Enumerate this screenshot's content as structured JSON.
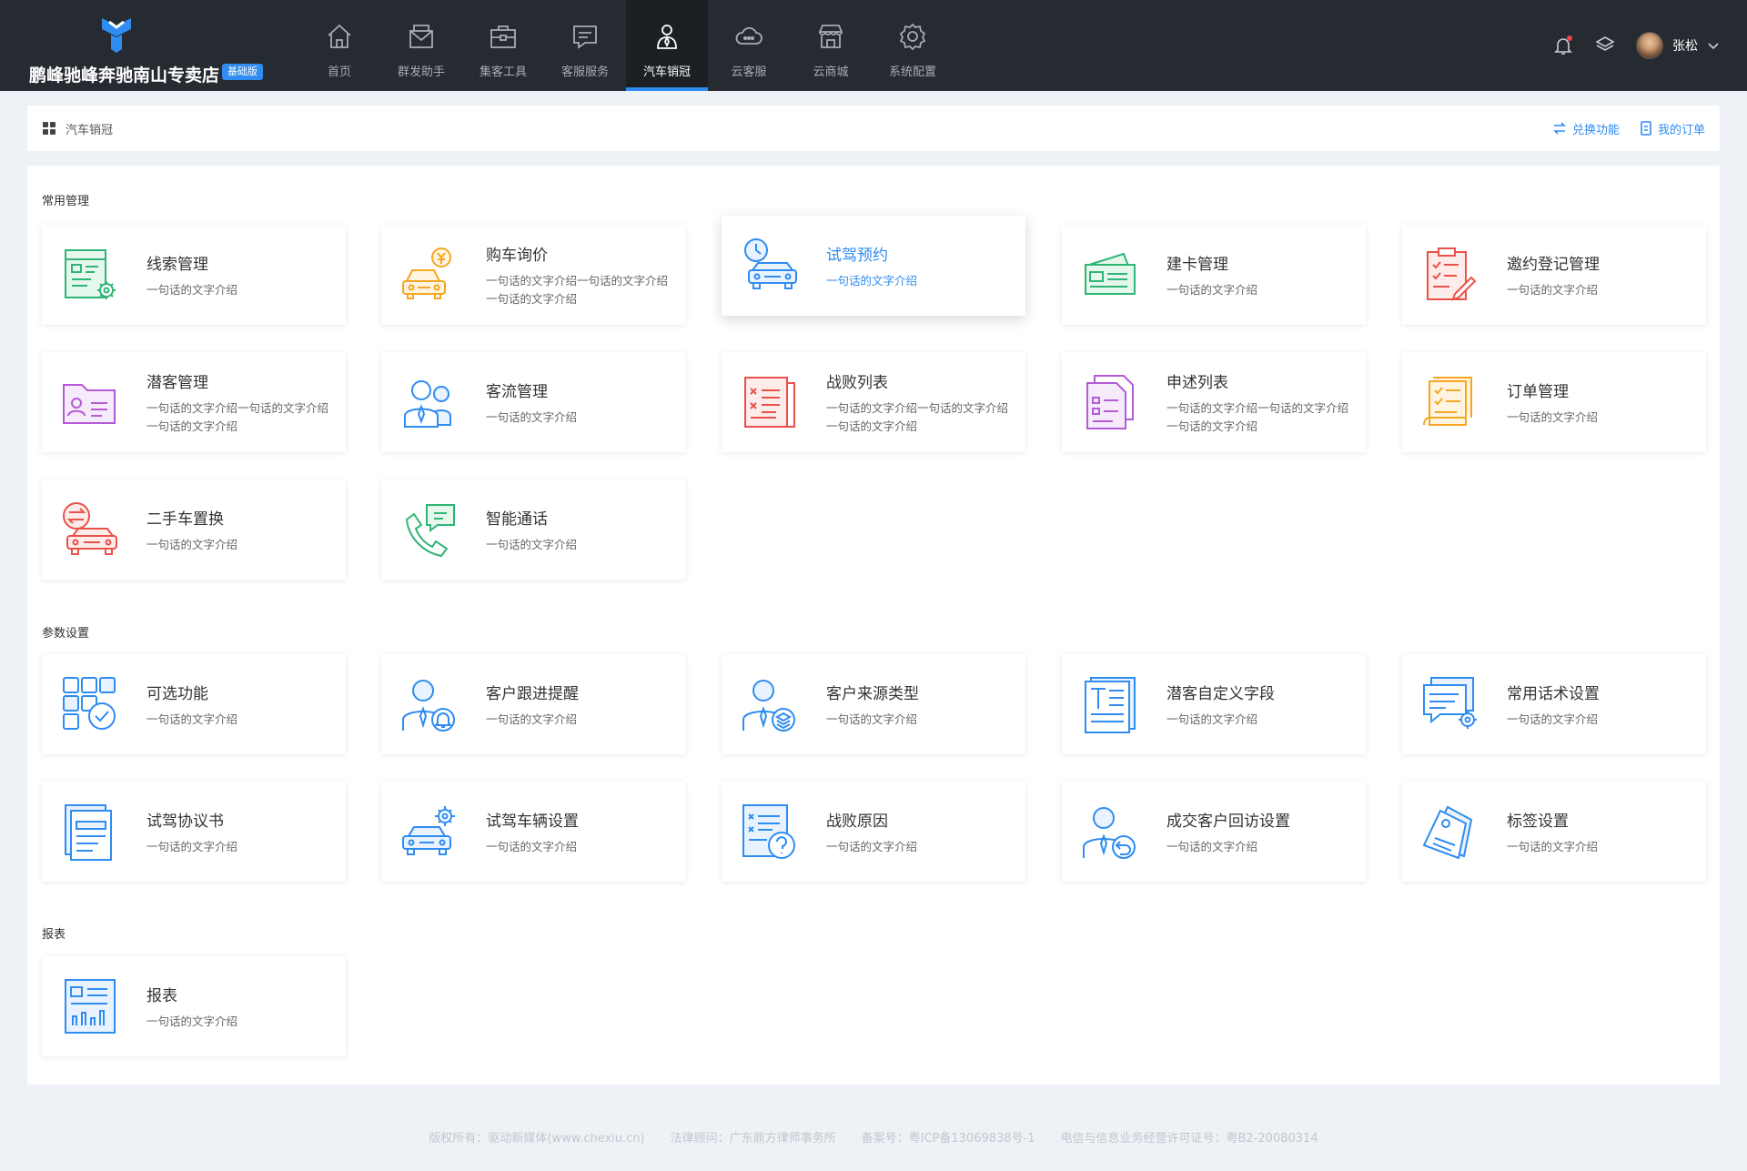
{
  "brand": {
    "name": "鹏峰驰峰奔驰南山专卖店",
    "badge": "基础版"
  },
  "nav": [
    {
      "label": "首页",
      "icon": "home-icon"
    },
    {
      "label": "群发助手",
      "icon": "mail-icon"
    },
    {
      "label": "集客工具",
      "icon": "toolbox-icon"
    },
    {
      "label": "客服服务",
      "icon": "message-icon"
    },
    {
      "label": "汽车销冠",
      "icon": "salesman-icon",
      "active": true
    },
    {
      "label": "云客服",
      "icon": "cloud-service-icon"
    },
    {
      "label": "云商城",
      "icon": "store-icon"
    },
    {
      "label": "系统配置",
      "icon": "gear-icon"
    }
  ],
  "user": {
    "name": "张松"
  },
  "breadcrumb": {
    "label": "汽车销冠",
    "exchange": "兑换功能",
    "orders": "我的订单"
  },
  "sections": {
    "common": "常用管理",
    "params": "参数设置",
    "report": "报表"
  },
  "colors": {
    "accent": "#2f8cf0",
    "topbar": "#262a31",
    "green": "#2fb574",
    "orange": "#f5a623",
    "red": "#e9524a",
    "purple": "#b45ad6"
  },
  "common_cards": [
    {
      "title": "线索管理",
      "desc": "一句话的文字介绍",
      "icon": "lead-gear-icon"
    },
    {
      "title": "购车询价",
      "desc": "一句话的文字介绍一句话的文字介绍一句话的文字介绍",
      "icon": "car-price-icon"
    },
    {
      "title": "试驾预约",
      "desc": "一句话的文字介绍",
      "icon": "car-clock-icon"
    },
    {
      "title": "建卡管理",
      "desc": "一句话的文字介绍",
      "icon": "cards-icon"
    },
    {
      "title": "邀约登记管理",
      "desc": "一句话的文字介绍",
      "icon": "clipboard-pen-icon"
    },
    {
      "title": "潜客管理",
      "desc": "一句话的文字介绍一句话的文字介绍一句话的文字介绍",
      "icon": "folder-contact-icon"
    },
    {
      "title": "客流管理",
      "desc": "一句话的文字介绍",
      "icon": "people-icon"
    },
    {
      "title": "战败列表",
      "desc": "一句话的文字介绍一句话的文字介绍一句话的文字介绍",
      "icon": "defeat-list-icon"
    },
    {
      "title": "申述列表",
      "desc": "一句话的文字介绍一句话的文字介绍一句话的文字介绍",
      "icon": "appeal-list-icon"
    },
    {
      "title": "订单管理",
      "desc": "一句话的文字介绍",
      "icon": "order-scroll-icon"
    },
    {
      "title": "二手车置换",
      "desc": "一句话的文字介绍",
      "icon": "car-exchange-icon"
    },
    {
      "title": "智能通话",
      "desc": "一句话的文字介绍",
      "icon": "phone-chat-icon"
    }
  ],
  "param_cards": [
    {
      "title": "可选功能",
      "desc": "一句话的文字介绍",
      "icon": "grid-check-icon"
    },
    {
      "title": "客户跟进提醒",
      "desc": "一句话的文字介绍",
      "icon": "person-bell-icon"
    },
    {
      "title": "客户来源类型",
      "desc": "一句话的文字介绍",
      "icon": "person-layers-icon"
    },
    {
      "title": "潜客自定义字段",
      "desc": "一句话的文字介绍",
      "icon": "text-doc-icon"
    },
    {
      "title": "常用话术设置",
      "desc": "一句话的文字介绍",
      "icon": "chat-gear-icon"
    },
    {
      "title": "试驾协议书",
      "desc": "一句话的文字介绍",
      "icon": "agreement-icon"
    },
    {
      "title": "试驾车辆设置",
      "desc": "一句话的文字介绍",
      "icon": "car-gear-icon"
    },
    {
      "title": "战败原因",
      "desc": "一句话的文字介绍",
      "icon": "reason-question-icon"
    },
    {
      "title": "成交客户回访设置",
      "desc": "一句话的文字介绍",
      "icon": "person-return-icon"
    },
    {
      "title": "标签设置",
      "desc": "一句话的文字介绍",
      "icon": "tag-icon"
    }
  ],
  "report_cards": [
    {
      "title": "报表",
      "desc": "一句话的文字介绍",
      "icon": "report-chart-icon"
    }
  ],
  "footer": {
    "copyright": "版权所有：驱动新媒体(www.chexiu.cn)",
    "legal": "法律顾问：广东鼎方律师事务所",
    "icp": "备案号：粤ICP备13069838号-1",
    "license": "电信与信息业务经营许可证号：粤B2-20080314"
  }
}
